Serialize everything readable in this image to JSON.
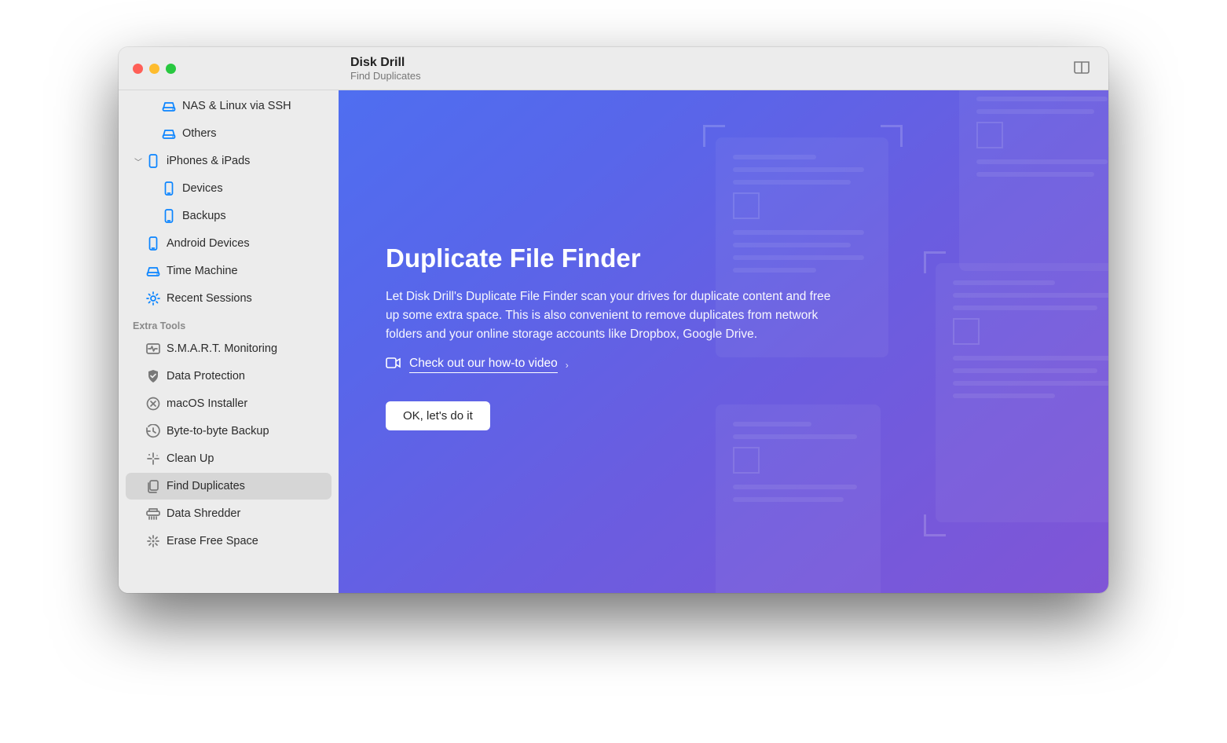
{
  "header": {
    "title": "Disk Drill",
    "subtitle": "Find Duplicates"
  },
  "sidebar": {
    "groups": [
      {
        "label": null,
        "items": [
          {
            "icon": "disk",
            "color": "blue",
            "indent": 1,
            "label": "NAS & Linux via SSH",
            "caret": null,
            "selected": false
          },
          {
            "icon": "disk",
            "color": "blue",
            "indent": 1,
            "label": "Others",
            "caret": null,
            "selected": false
          },
          {
            "icon": "phone-outline",
            "color": "blue",
            "indent": 0,
            "label": "iPhones & iPads",
            "caret": "down",
            "selected": false
          },
          {
            "icon": "phone",
            "color": "blue",
            "indent": 1,
            "label": "Devices",
            "caret": null,
            "selected": false
          },
          {
            "icon": "phone",
            "color": "blue",
            "indent": 1,
            "label": "Backups",
            "caret": null,
            "selected": false
          },
          {
            "icon": "phone",
            "color": "blue",
            "indent": 0,
            "label": "Android Devices",
            "caret": null,
            "selected": false
          },
          {
            "icon": "disk",
            "color": "blue",
            "indent": 0,
            "label": "Time Machine",
            "caret": null,
            "selected": false
          },
          {
            "icon": "gear",
            "color": "blue",
            "indent": 0,
            "label": "Recent Sessions",
            "caret": null,
            "selected": false
          }
        ]
      },
      {
        "label": "Extra Tools",
        "items": [
          {
            "icon": "heartbeat",
            "color": "gray",
            "indent": 0,
            "label": "S.M.A.R.T. Monitoring",
            "caret": null,
            "selected": false
          },
          {
            "icon": "shield",
            "color": "gray",
            "indent": 0,
            "label": "Data Protection",
            "caret": null,
            "selected": false
          },
          {
            "icon": "x-circle",
            "color": "gray",
            "indent": 0,
            "label": "macOS Installer",
            "caret": null,
            "selected": false
          },
          {
            "icon": "clock",
            "color": "gray",
            "indent": 0,
            "label": "Byte-to-byte Backup",
            "caret": null,
            "selected": false
          },
          {
            "icon": "sparkle",
            "color": "gray",
            "indent": 0,
            "label": "Clean Up",
            "caret": null,
            "selected": false
          },
          {
            "icon": "copies",
            "color": "gray",
            "indent": 0,
            "label": "Find Duplicates",
            "caret": null,
            "selected": true
          },
          {
            "icon": "shredder",
            "color": "gray",
            "indent": 0,
            "label": "Data Shredder",
            "caret": null,
            "selected": false
          },
          {
            "icon": "burst",
            "color": "gray",
            "indent": 0,
            "label": "Erase Free Space",
            "caret": null,
            "selected": false
          }
        ]
      }
    ]
  },
  "main": {
    "heading": "Duplicate File Finder",
    "description": "Let Disk Drill's Duplicate File Finder scan your drives for duplicate content and free up some extra space. This is also convenient to remove duplicates from network folders and your online storage accounts like Dropbox, Google Drive.",
    "howto_link": "Check out our how-to video",
    "cta": "OK, let's do it"
  }
}
